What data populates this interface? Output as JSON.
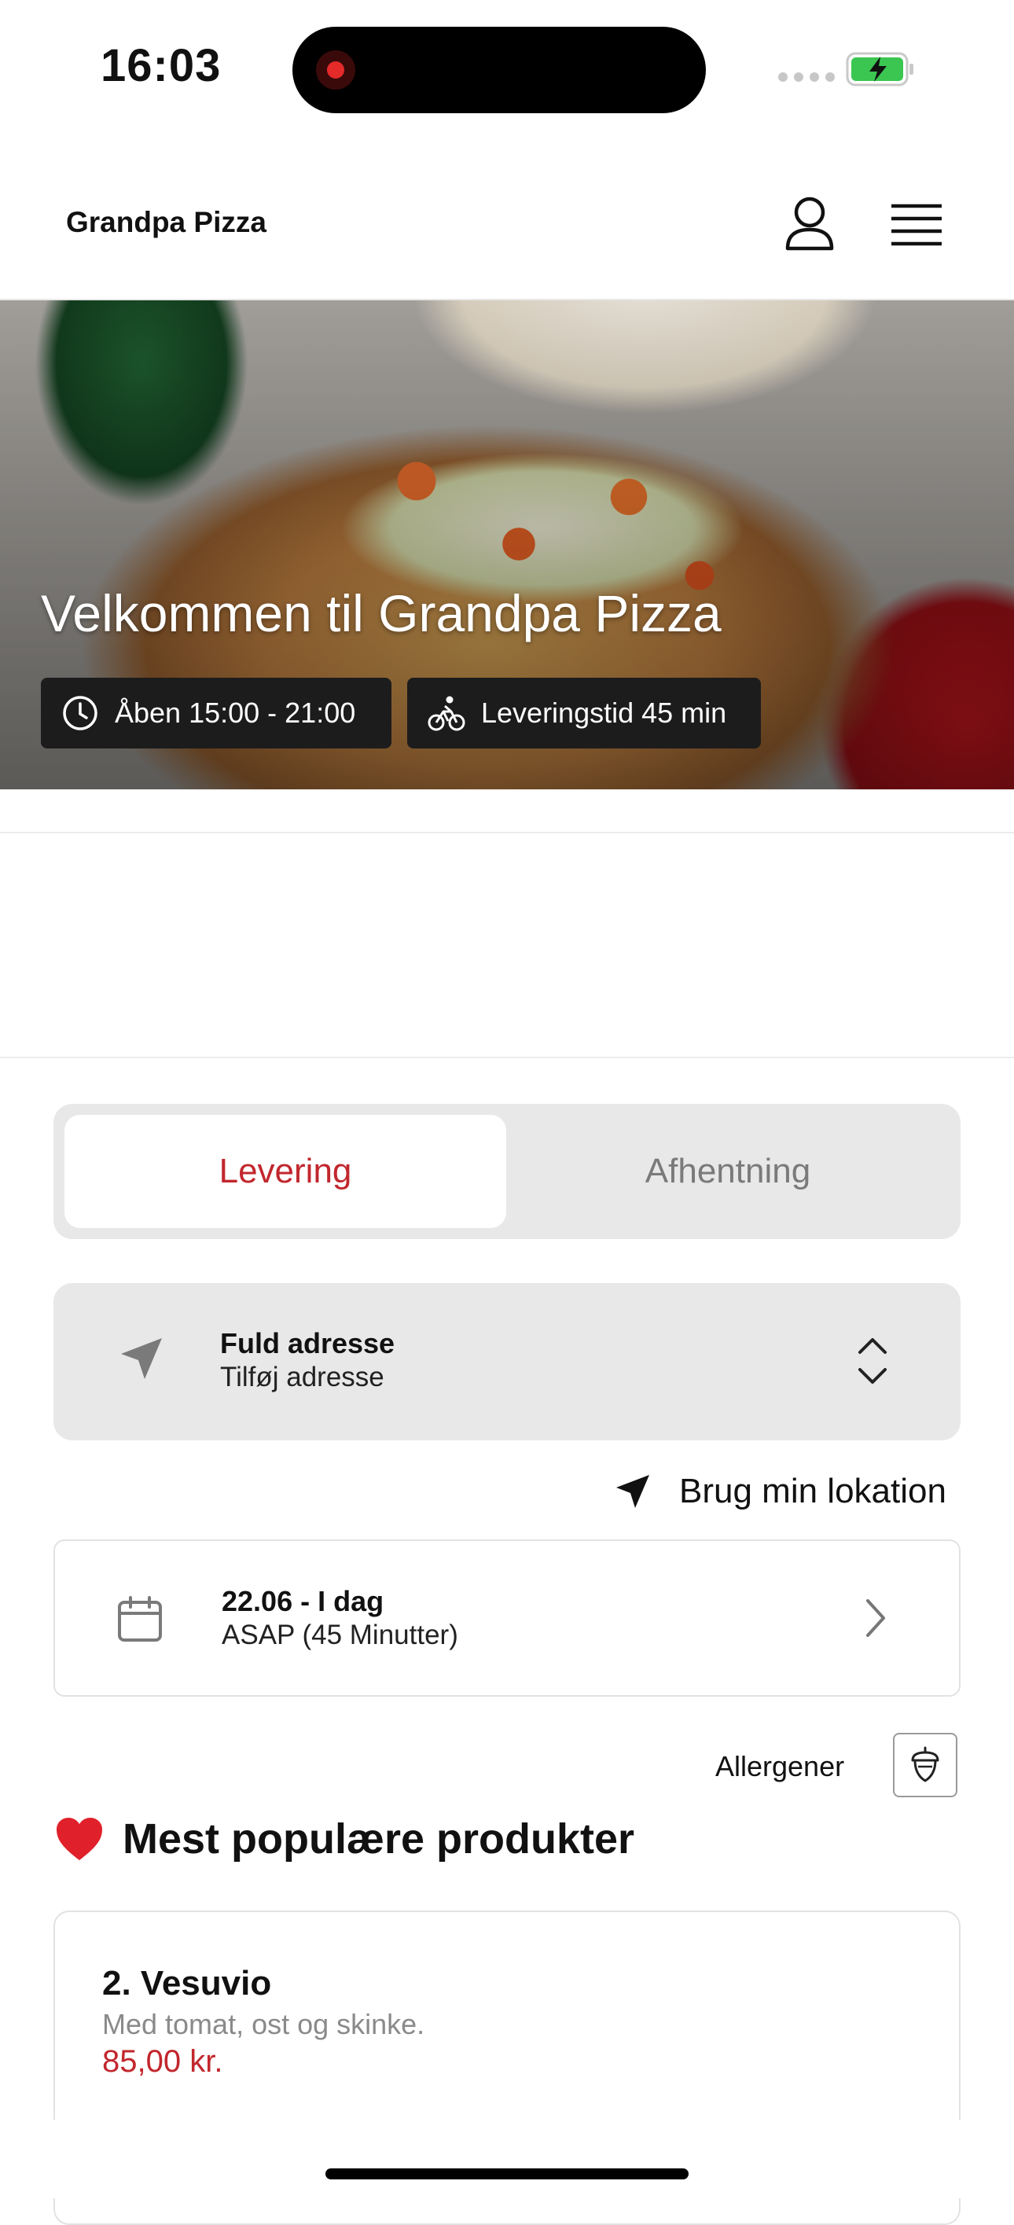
{
  "status_bar": {
    "time": "16:03"
  },
  "header": {
    "brand": "Grandpa Pizza"
  },
  "hero": {
    "title": "Velkommen til Grandpa Pizza",
    "open_hours": "Åben 15:00 - 21:00",
    "delivery_time": "Leveringstid 45 min"
  },
  "order_mode": {
    "options": [
      "Levering",
      "Afhentning"
    ],
    "selected": "Levering"
  },
  "address": {
    "title": "Fuld adresse",
    "subtitle": "Tilføj adresse"
  },
  "use_location": {
    "label": "Brug min lokation"
  },
  "schedule": {
    "date": "22.06 - I dag",
    "time": "ASAP (45 Minutter)"
  },
  "allergens": {
    "label": "Allergener"
  },
  "popular": {
    "title": "Mest populære produkter",
    "products": [
      {
        "name": "2. Vesuvio",
        "description": "Med tomat, ost og skinke.",
        "price": "85,00 kr."
      }
    ]
  },
  "colors": {
    "accent": "#c1272d",
    "card_bg": "#e8e8e8",
    "pill_bg": "#1c1c1c"
  },
  "icons": [
    "clock-icon",
    "bike-icon",
    "user-icon",
    "menu-icon",
    "location-arrow-icon",
    "chevron-up-down-icon",
    "calendar-icon",
    "chevron-right-icon",
    "acorn-icon",
    "heart-icon"
  ]
}
